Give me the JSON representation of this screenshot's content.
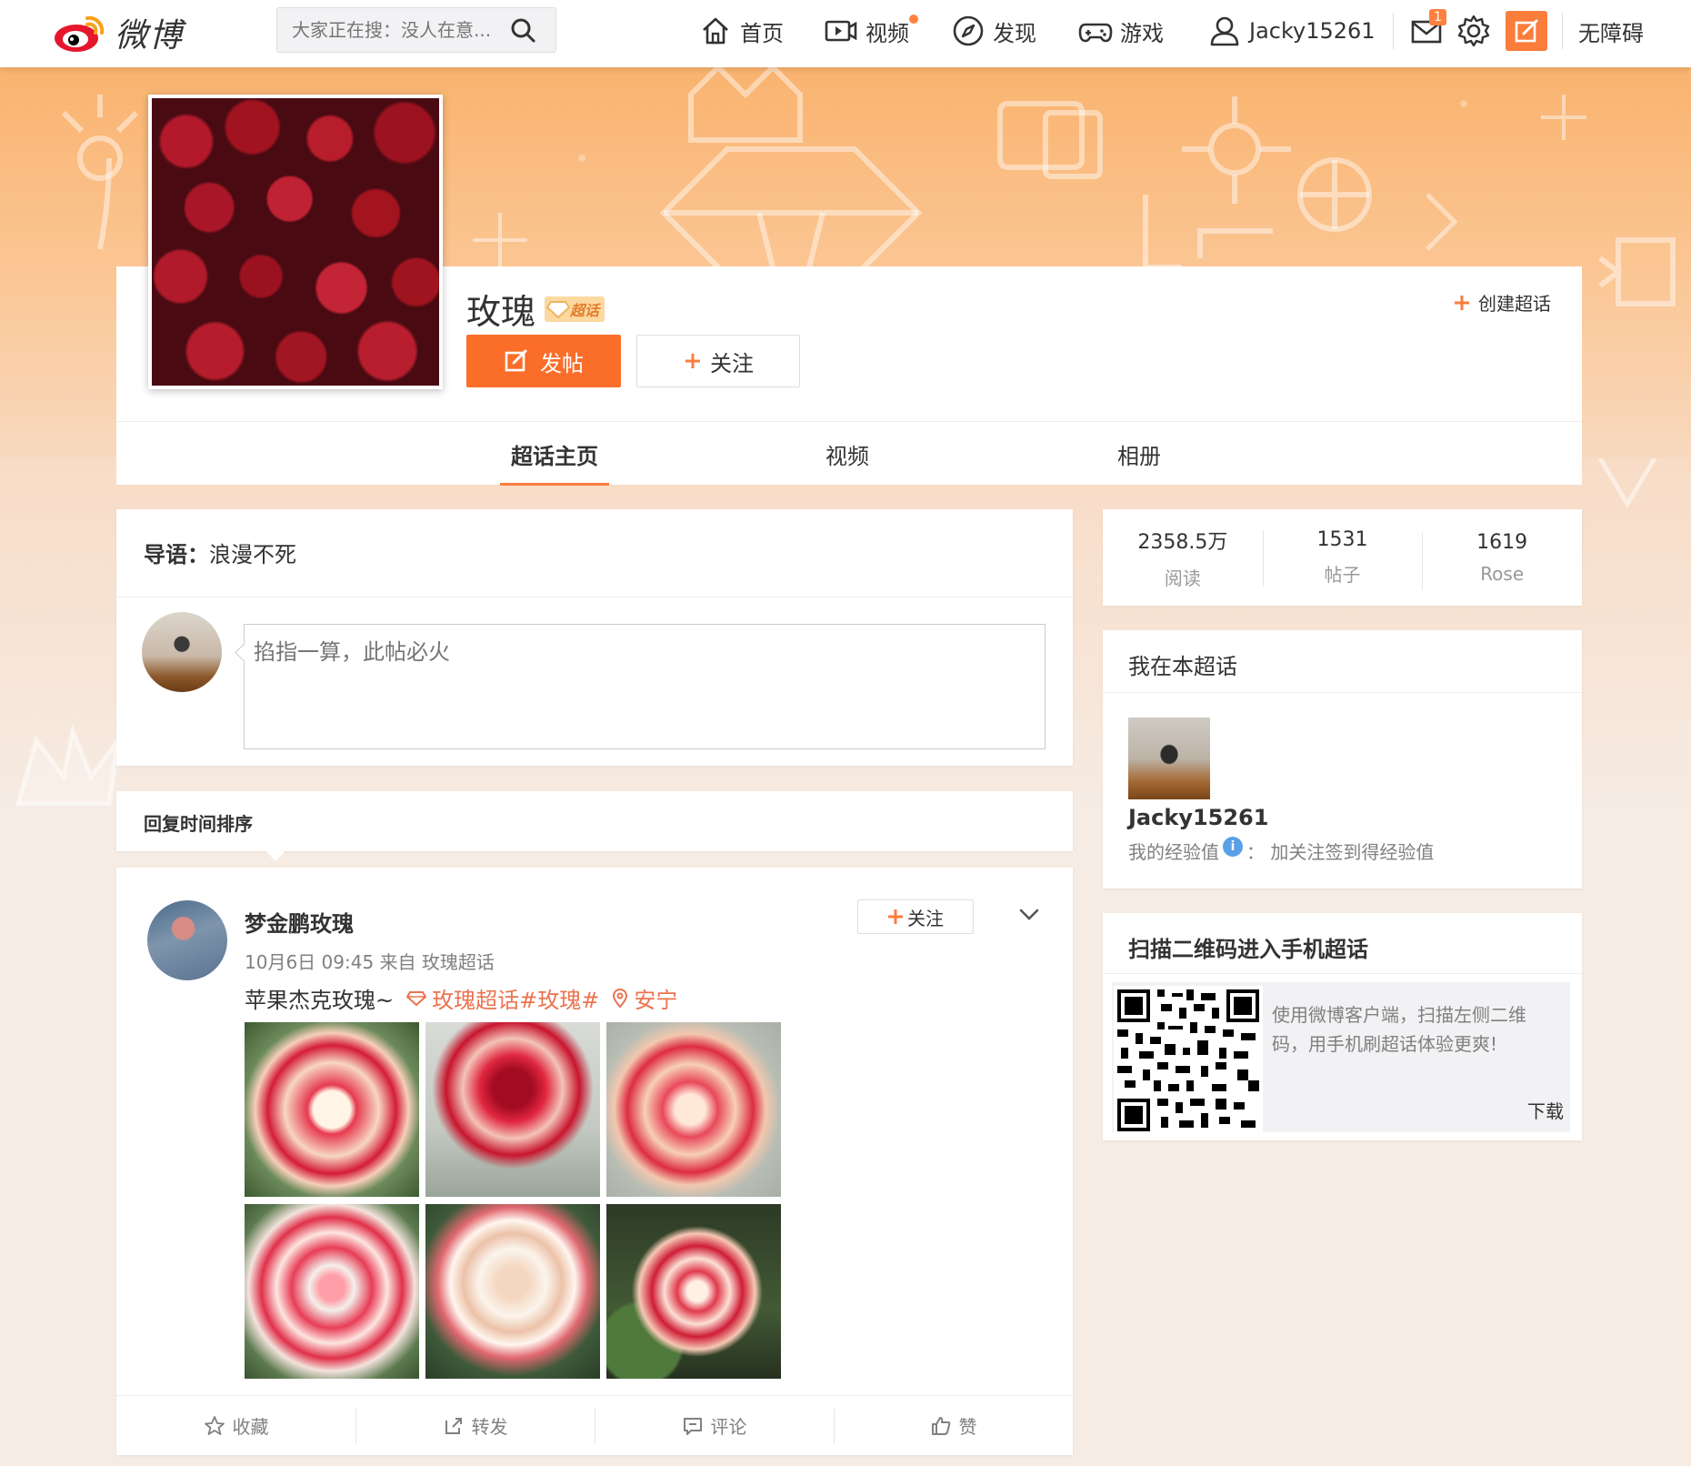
{
  "header": {
    "logo_text": "微博",
    "search_placeholder": "大家正在搜：没人在意...",
    "nav": {
      "home": "首页",
      "video": "视频",
      "discover": "发现",
      "games": "游戏",
      "user": "Jacky15261",
      "message_count": "1",
      "accessibility": "无障碍"
    }
  },
  "topic": {
    "name": "玫瑰",
    "badge": "超话",
    "post_button": "发帖",
    "follow_button": "关注",
    "create_link": "创建超话",
    "tabs": [
      "超话主页",
      "视频",
      "相册"
    ]
  },
  "intro": {
    "label": "导语：",
    "text": "浪漫不死",
    "compose_placeholder": "掐指一算，此帖必火"
  },
  "sort_label": "回复时间排序",
  "post": {
    "user": "梦金鹏玫瑰",
    "follow_label": "关注",
    "meta": "10月6日 09:45 来自 玫瑰超话",
    "text": "苹果杰克玫瑰~",
    "tag": "玫瑰超话#玫瑰#",
    "location": "安宁",
    "actions": [
      "收藏",
      "转发",
      "评论",
      "赞"
    ]
  },
  "stats": [
    {
      "value": "2358.5万",
      "label": "阅读"
    },
    {
      "value": "1531",
      "label": "帖子"
    },
    {
      "value": "1619",
      "label": "Rose"
    }
  ],
  "me": {
    "title": "我在本超话",
    "name": "Jacky15261",
    "exp_label": "我的经验值",
    "exp_text": "：  加关注签到得经验值"
  },
  "qr": {
    "title": "扫描二维码进入手机超话",
    "desc": "使用微博客户端，扫描左侧二维码，用手机刷超话体验更爽!",
    "download": "下载"
  },
  "colors": {
    "accent": "#fa7d3c",
    "tag": "#eb7350"
  }
}
